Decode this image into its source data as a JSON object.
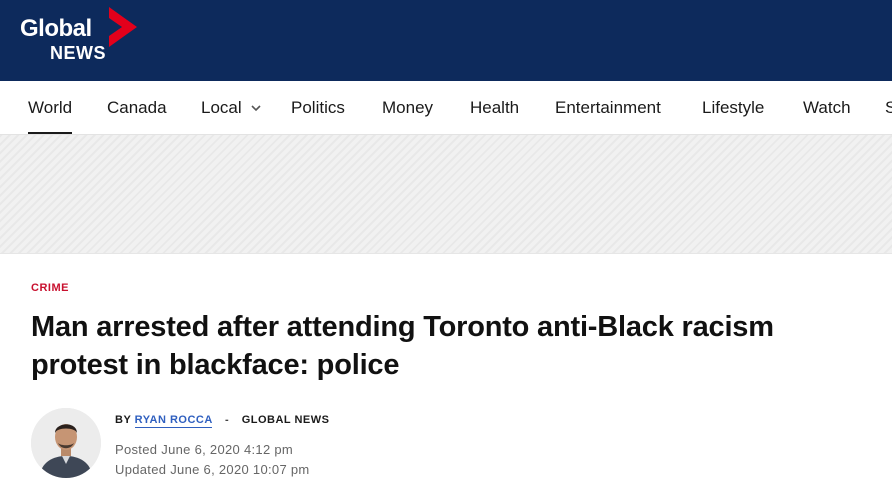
{
  "brand": {
    "line1": "Global",
    "line2": "NEWS",
    "navy": "#0d2a5c",
    "red": "#e3001b"
  },
  "nav": {
    "items": [
      {
        "label": "World",
        "active": true
      },
      {
        "label": "Canada"
      },
      {
        "label": "Local",
        "has_dropdown": true
      },
      {
        "label": "Politics"
      },
      {
        "label": "Money"
      },
      {
        "label": "Health"
      },
      {
        "label": "Entertainment"
      },
      {
        "label": "Lifestyle"
      },
      {
        "label": "Watch"
      },
      {
        "label": "S"
      }
    ]
  },
  "article": {
    "category": "CRIME",
    "headline": "Man arrested after attending Toronto anti-Black racism protest in blackface: police",
    "byline": {
      "prefix": "BY",
      "author": "RYAN ROCCA",
      "separator": "-",
      "source": "GLOBAL NEWS"
    },
    "posted_label": "Posted",
    "posted_date": "June 6, 2020 4:12 pm",
    "updated_label": "Updated",
    "updated_date": "June 6, 2020 10:07 pm",
    "category_color": "#c8102e",
    "link_color": "#2f5fbf"
  }
}
